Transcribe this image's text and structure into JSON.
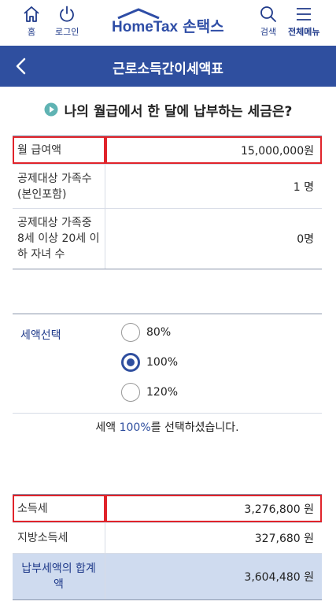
{
  "topbar": {
    "home_label": "홈",
    "login_label": "로그인",
    "logo_en": "HomeTax",
    "logo_ko": "손택스",
    "search_label": "검색",
    "menu_label": "전체메뉴"
  },
  "titlebar": {
    "title": "근로소득간이세액표"
  },
  "question": {
    "text": "나의 월급에서 한 달에 납부하는 세금은?"
  },
  "input_table": [
    {
      "label": "월 급여액",
      "value": "15,000,000원"
    },
    {
      "label": "공제대상 가족수(본인포함)",
      "value": "1 명"
    },
    {
      "label": "공제대상 가족중 8세 이상 20세 이하 자녀 수",
      "value": "0명"
    }
  ],
  "tax_select": {
    "label": "세액선택",
    "options": [
      "80%",
      "100%",
      "120%"
    ],
    "selected": "100%",
    "message_prefix": "세액 ",
    "message_pct": "100%",
    "message_suffix": "를 선택하셨습니다."
  },
  "result_table": [
    {
      "label": "소득세",
      "value": "3,276,800 원"
    },
    {
      "label": "지방소득세",
      "value": "327,680 원"
    },
    {
      "label": "납부세액의 합계액",
      "value": "3,604,480 원"
    }
  ],
  "colors": {
    "brand": "#2f4f9f",
    "highlight": "#e0242b",
    "total_bg": "#cfdbef"
  }
}
